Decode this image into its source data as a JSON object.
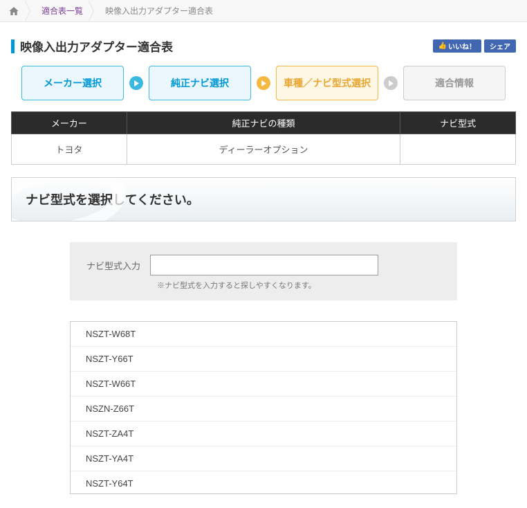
{
  "breadcrumb": {
    "list_label": "適合表一覧",
    "current": "映像入出力アダプター適合表"
  },
  "title": "映像入出力アダプター適合表",
  "social": {
    "like": "いいね！",
    "share": "シェア"
  },
  "steps": {
    "s1": "メーカー選択",
    "s2": "純正ナビ選択",
    "s3": "車種／ナビ型式選択",
    "s4": "適合情報"
  },
  "table": {
    "head": {
      "c1": "メーカー",
      "c2": "純正ナビの種類",
      "c3": "ナビ型式"
    },
    "row": {
      "c1": "トヨタ",
      "c2": "ディーラーオプション",
      "c3": ""
    }
  },
  "prompt": "ナビ型式を選択してください。",
  "input": {
    "label": "ナビ型式入力",
    "hint": "※ナビ型式を入力すると探しやすくなります。"
  },
  "list": {
    "i0": "NSZT-W68T",
    "i1": "NSZT-Y66T",
    "i2": "NSZT-W66T",
    "i3": "NSZN-Z66T",
    "i4": "NSZT-ZA4T",
    "i5": "NSZT-YA4T",
    "i6": "NSZT-Y64T"
  }
}
